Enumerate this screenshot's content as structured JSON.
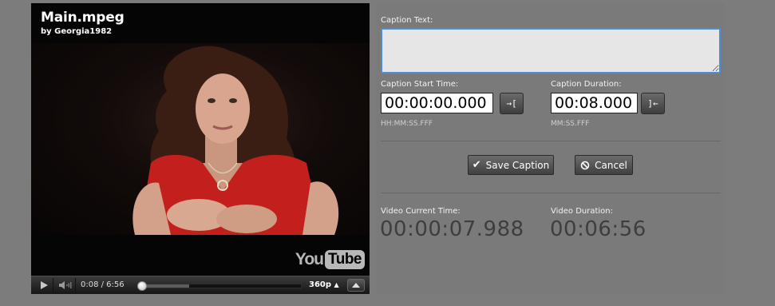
{
  "player": {
    "title": "Main.mpeg",
    "byline": "by Georgia1982",
    "logo_you": "You",
    "logo_tube": "Tube",
    "time_display": "0:08 / 6:56",
    "quality": "360p",
    "progress_fraction": 0.02,
    "buffered_fraction": 0.31
  },
  "caption_form": {
    "caption_text_label": "Caption Text:",
    "caption_text_value": "",
    "start_time_label": "Caption Start Time:",
    "start_time_value": "00:00:00.000",
    "start_time_hint": "HH:MM:SS.FFF",
    "start_set_icon": "→[",
    "duration_label": "Caption Duration:",
    "duration_value": "00:08.000",
    "duration_hint": "MM:SS.FFF",
    "duration_set_icon": "]←",
    "save_label": "Save Caption",
    "cancel_label": "Cancel"
  },
  "status": {
    "current_time_label": "Video Current Time:",
    "current_time_value": "00:00:07.988",
    "duration_label": "Video Duration:",
    "duration_value": "00:06:56"
  },
  "colors": {
    "page_bg": "#7c7c7c",
    "focus_border": "#4d8dd6",
    "video_bg": "#000000"
  }
}
